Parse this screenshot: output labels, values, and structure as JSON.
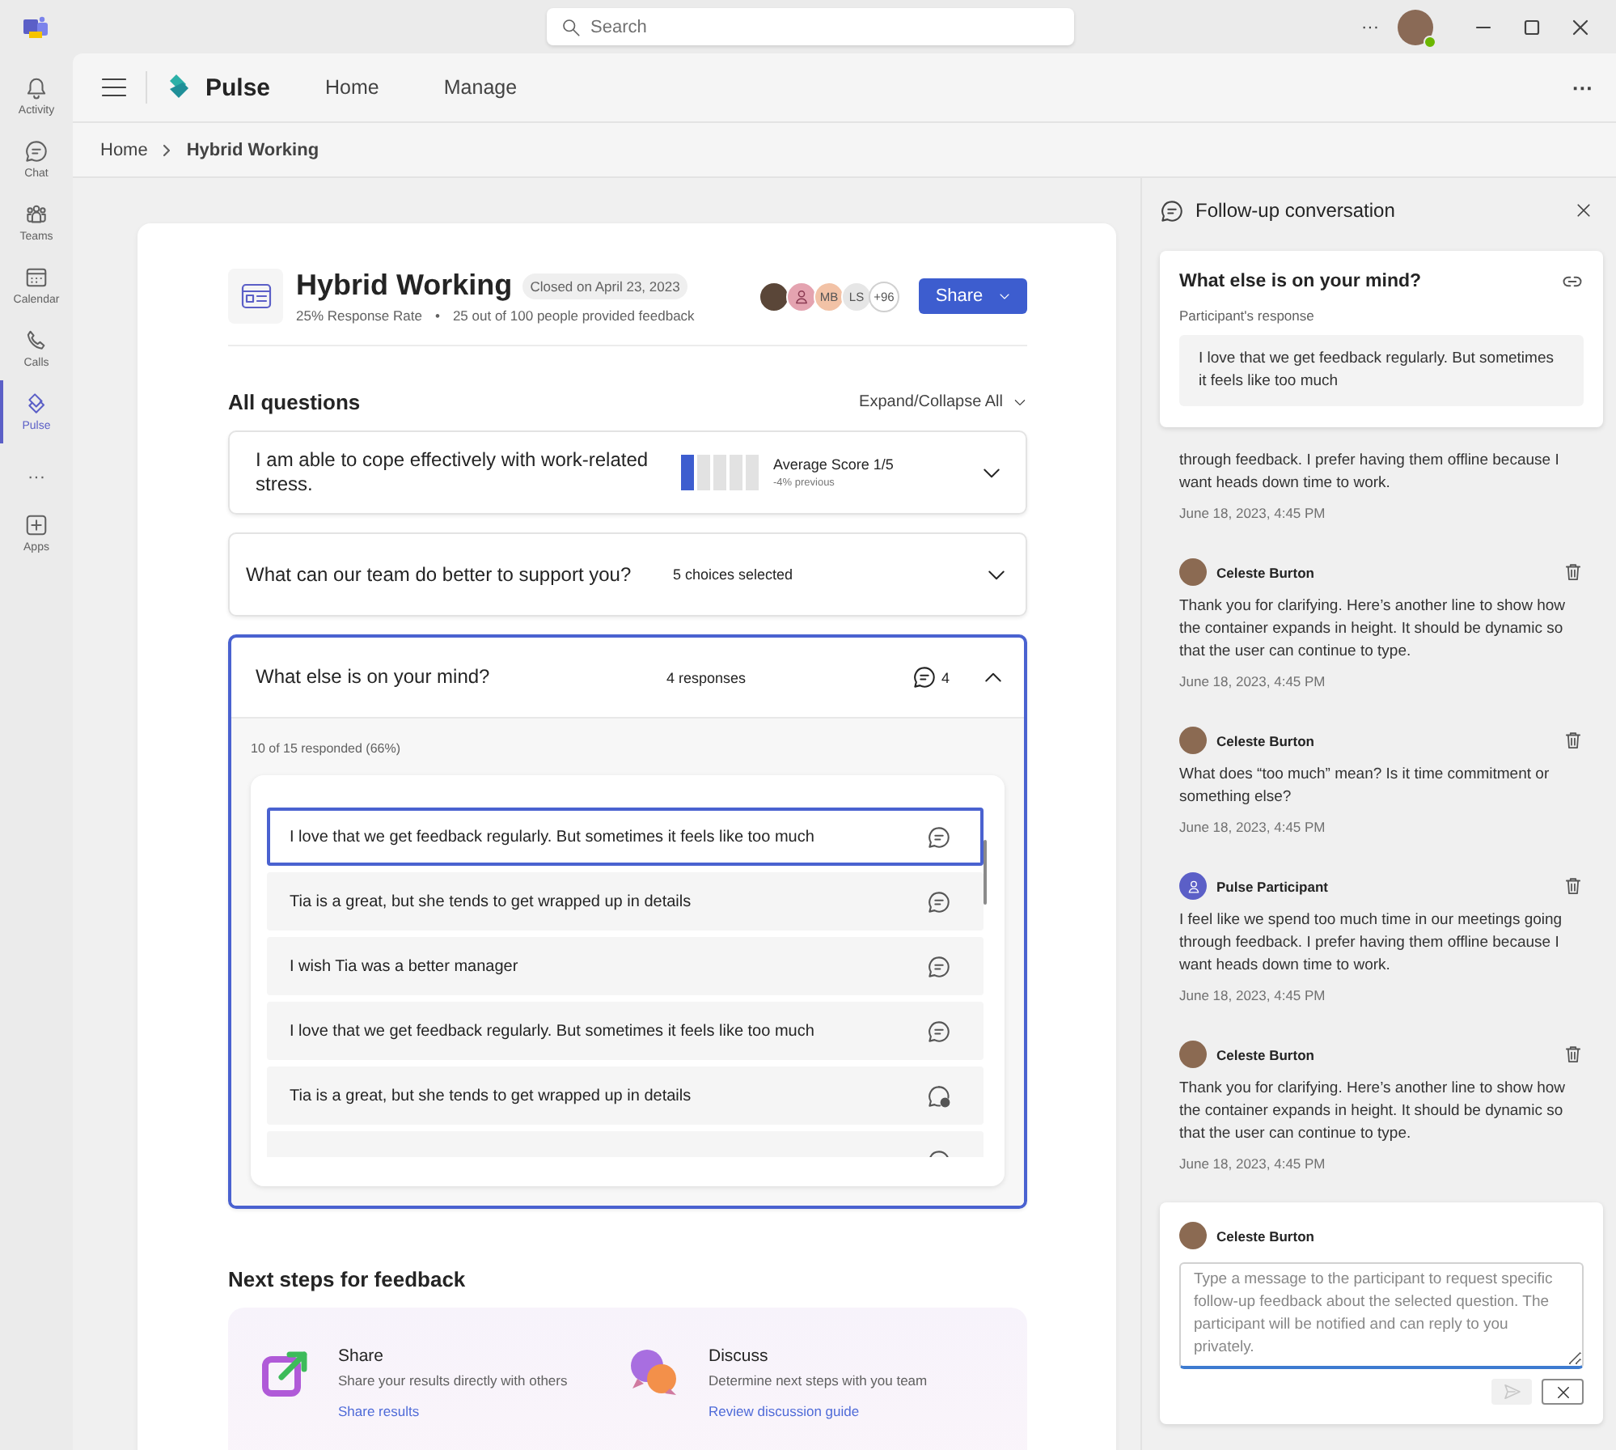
{
  "title_bar": {
    "search": {
      "placeholder": "Search"
    },
    "more": "···"
  },
  "rail": {
    "items": [
      {
        "label": "Activity",
        "selected": false
      },
      {
        "label": "Chat",
        "selected": false
      },
      {
        "label": "Teams",
        "selected": false
      },
      {
        "label": "Calendar",
        "selected": false
      },
      {
        "label": "Calls",
        "selected": false
      },
      {
        "label": "Pulse",
        "selected": true
      }
    ],
    "more": "···",
    "apps": {
      "label": "Apps"
    }
  },
  "app_header": {
    "name": "Pulse",
    "nav": [
      {
        "label": "Home",
        "selected": false
      },
      {
        "label": "Manage",
        "selected": false
      }
    ],
    "more": "···"
  },
  "breadcrumb": [
    "Home",
    "Hybrid Working"
  ],
  "survey": {
    "title": "Hybrid Working",
    "status": "Closed on April 23, 2023",
    "response_rate": "25% Response Rate",
    "separator": "•",
    "feedback": "25 out of 100 people provided feedback",
    "avatars": [
      {
        "kind": "photo"
      },
      {
        "kind": "person",
        "color": "#e4a3b0"
      },
      {
        "kind": "initials",
        "text": "MB",
        "color": "#f2c2a6"
      },
      {
        "kind": "initials",
        "text": "LS",
        "color": "#e6e6e6"
      },
      {
        "kind": "count",
        "text": "+96",
        "color": "#ffffff"
      }
    ],
    "share_button": "Share"
  },
  "questions_heading": "All questions",
  "expand_collapse": "Expand/Collapse All",
  "questions": [
    {
      "kind": "score",
      "text": "I am able to cope effectively with work-related stress.",
      "level": 0.2,
      "score": "Average Score 1/5",
      "delta": "-4% previous",
      "expanded": false
    },
    {
      "kind": "choice",
      "text": "What can our team do better to support you?",
      "summary": "5 choices selected",
      "expanded": false
    },
    {
      "kind": "open",
      "text": "What else is on your mind?",
      "summary": "4 responses",
      "comment_count": "4",
      "expanded": true,
      "respondents": "10 of 15 responded (66%)",
      "responses": [
        {
          "text": "I love that we get feedback regularly. But sometimes it feels like too much",
          "kind": "comment",
          "selected": true
        },
        {
          "text": "Tia is a great, but she tends to get wrapped up in details",
          "kind": "comment",
          "selected": false
        },
        {
          "text": "I wish Tia was a better manager",
          "kind": "comment",
          "selected": false
        },
        {
          "text": "I love that we get feedback regularly. But sometimes it feels like too much",
          "kind": "comment",
          "selected": false
        },
        {
          "text": "Tia is a great, but she tends to get wrapped up in details",
          "kind": "comment-add",
          "selected": false
        },
        {
          "kind": "comment",
          "selected": false
        }
      ]
    }
  ],
  "next_steps": {
    "heading": "Next steps for feedback",
    "items": [
      {
        "kind": "share",
        "title": "Share",
        "description": "Share your results directly with others",
        "link": "Share results"
      },
      {
        "kind": "discuss",
        "title": "Discuss",
        "description": "Determine next steps with you team",
        "link": "Review discussion guide"
      }
    ]
  },
  "panel": {
    "title": "Follow-up conversation",
    "question": {
      "title": "What else is on your mind?",
      "label": "Participant's response",
      "response": "I love that we get feedback regularly. But sometimes it feels like too much"
    },
    "messages": [
      {
        "text": "through feedback. I prefer having them offline because I want heads down time to work.",
        "time": "June 18, 2023, 4:45 PM"
      },
      {
        "kind": "host",
        "author": "Celeste Burton",
        "text": "Thank you for clarifying. Here’s another line to show how the container expands in height. It should be dynamic so that the user can continue to type.",
        "time": "June 18, 2023, 4:45 PM"
      },
      {
        "kind": "host",
        "author": "Celeste Burton",
        "text": "What does “too much” mean? Is it time commitment or something else?",
        "time": "June 18, 2023, 4:45 PM"
      },
      {
        "kind": "participant",
        "author": "Pulse Participant",
        "text": "I feel like we spend too much time in our meetings going through feedback. I prefer having them offline because I want heads down time to work.",
        "time": "June 18, 2023, 4:45 PM"
      },
      {
        "kind": "host",
        "author": "Celeste Burton",
        "text": "Thank you for clarifying. Here’s another line to show how the container expands in height. It should be dynamic so that the user can continue to type.",
        "time": "June 18, 2023, 4:45 PM"
      }
    ],
    "composer": {
      "author": "Celeste Burton",
      "placeholder": "Type a message to the participant to request specific follow-up feedback about the selected question. The participant will be notified and can reply to you privately.",
      "send_disabled": true
    }
  }
}
